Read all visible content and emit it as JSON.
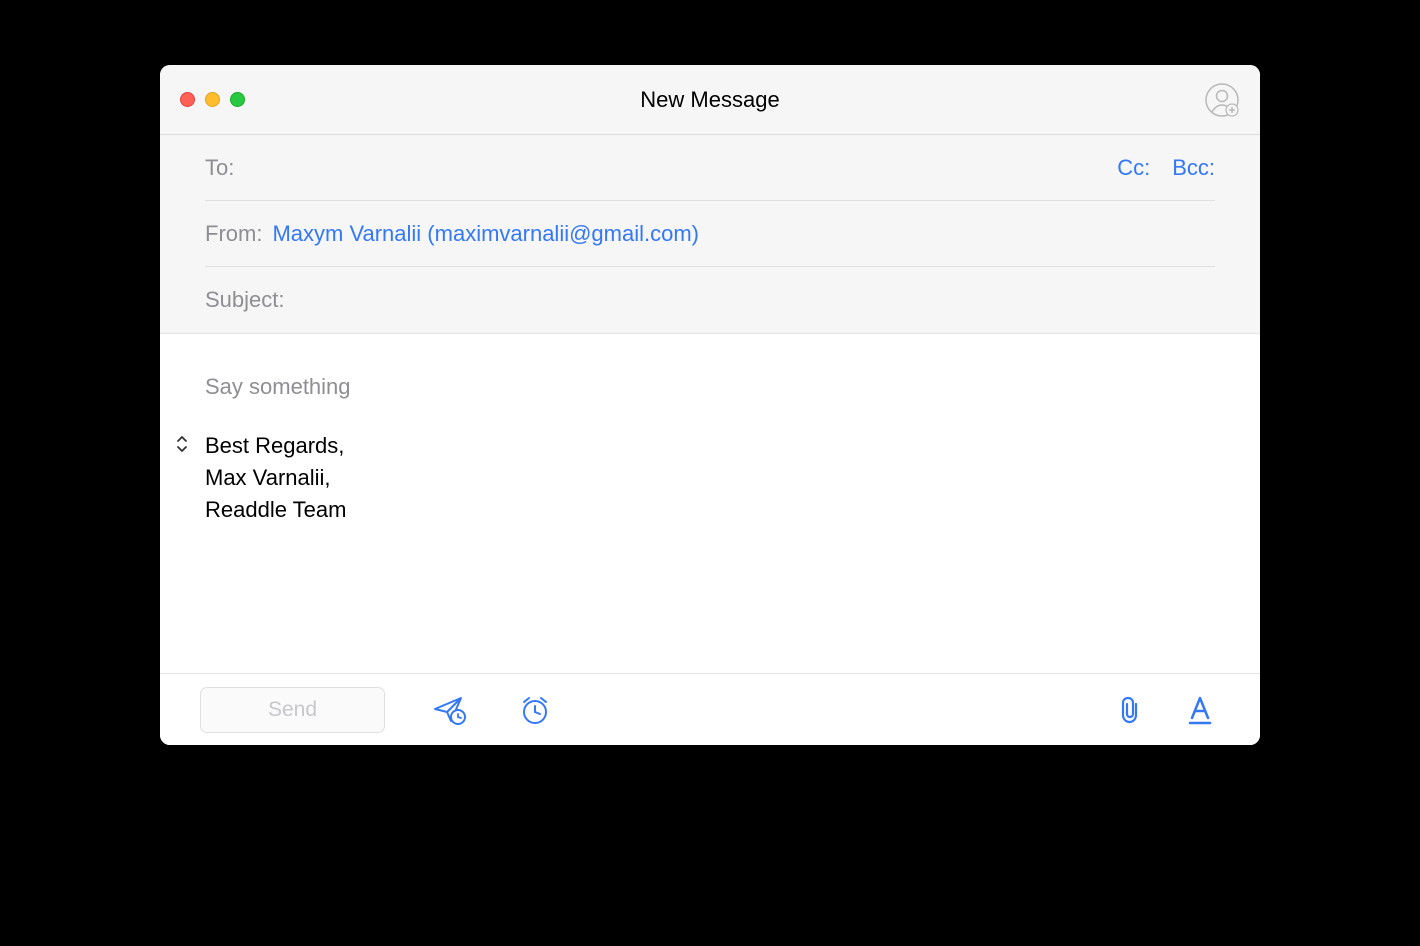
{
  "window": {
    "title": "New Message"
  },
  "fields": {
    "to_label": "To:",
    "to_value": "",
    "cc_label": "Cc:",
    "bcc_label": "Bcc:",
    "from_label": "From:",
    "from_value": "Maxym Varnalii (maximvarnalii@gmail.com)",
    "subject_label": "Subject:",
    "subject_value": ""
  },
  "body": {
    "placeholder": "Say something",
    "signature_line1": "Best Regards,",
    "signature_line2": "Max Varnalii,",
    "signature_line3": "Readdle Team"
  },
  "toolbar": {
    "send_label": "Send"
  },
  "colors": {
    "accent": "#3478f6"
  }
}
